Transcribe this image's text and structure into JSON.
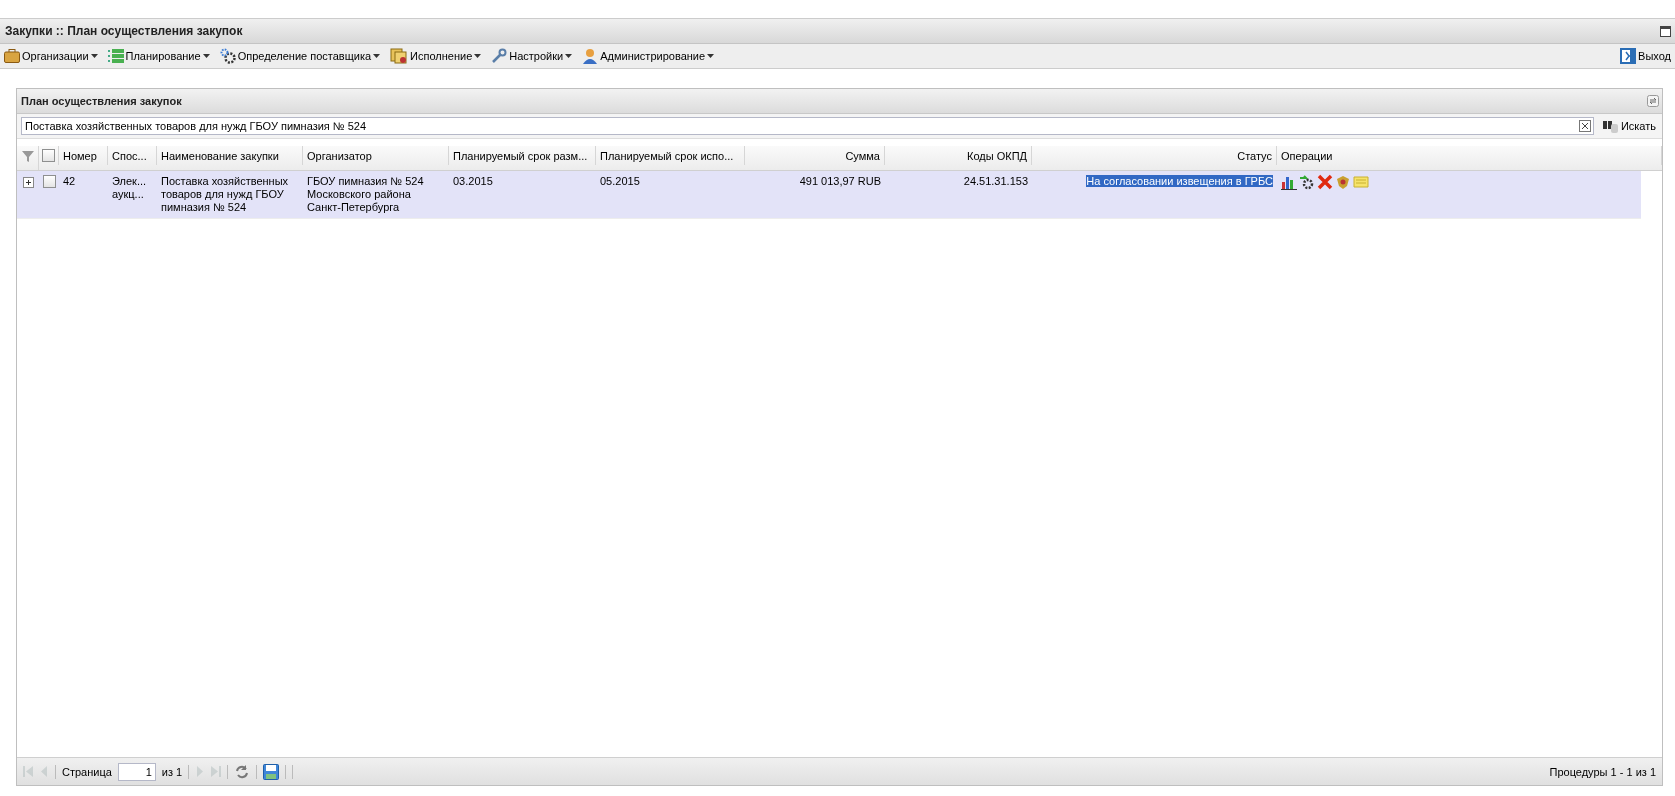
{
  "window": {
    "title": "Закупки :: План осуществления закупок"
  },
  "menu": {
    "items": [
      {
        "label": "Организации"
      },
      {
        "label": "Планирование"
      },
      {
        "label": "Определение поставщика"
      },
      {
        "label": "Исполнение"
      },
      {
        "label": "Настройки"
      },
      {
        "label": "Администрирование"
      }
    ],
    "exit": "Выход"
  },
  "panel": {
    "title": "План осуществления закупок",
    "search": {
      "value": "Поставка хозяйственных товаров для нужд ГБОУ пимназия № 524",
      "button": "Искать"
    }
  },
  "table": {
    "all_checked": false,
    "columns": [
      "Номер",
      "Спос...",
      "Наименование закупки",
      "Организатор",
      "Планируемый срок разм...",
      "Планируемый срок испо...",
      "Сумма",
      "Коды ОКПД",
      "Статус",
      "Операции"
    ],
    "rows": [
      {
        "selected": true,
        "expanded": false,
        "checked": false,
        "status_highlighted": true,
        "cells": [
          "42",
          "Элек... аукц...",
          "Поставка хозяйственных товаров для нужд ГБОУ пимназия № 524",
          "ГБОУ пимназия № 524 Московского района Санкт-Петербурга",
          "03.2015",
          "05.2015",
          "491 013,97 RUB",
          "24.51.31.153",
          "На согласовании извещения в  ГРБС"
        ]
      }
    ]
  },
  "pager": {
    "page_label": "Страница",
    "page": "1",
    "of": "из 1",
    "nav_disabled": true,
    "summary": "Процедуры 1 - 1 из 1"
  }
}
